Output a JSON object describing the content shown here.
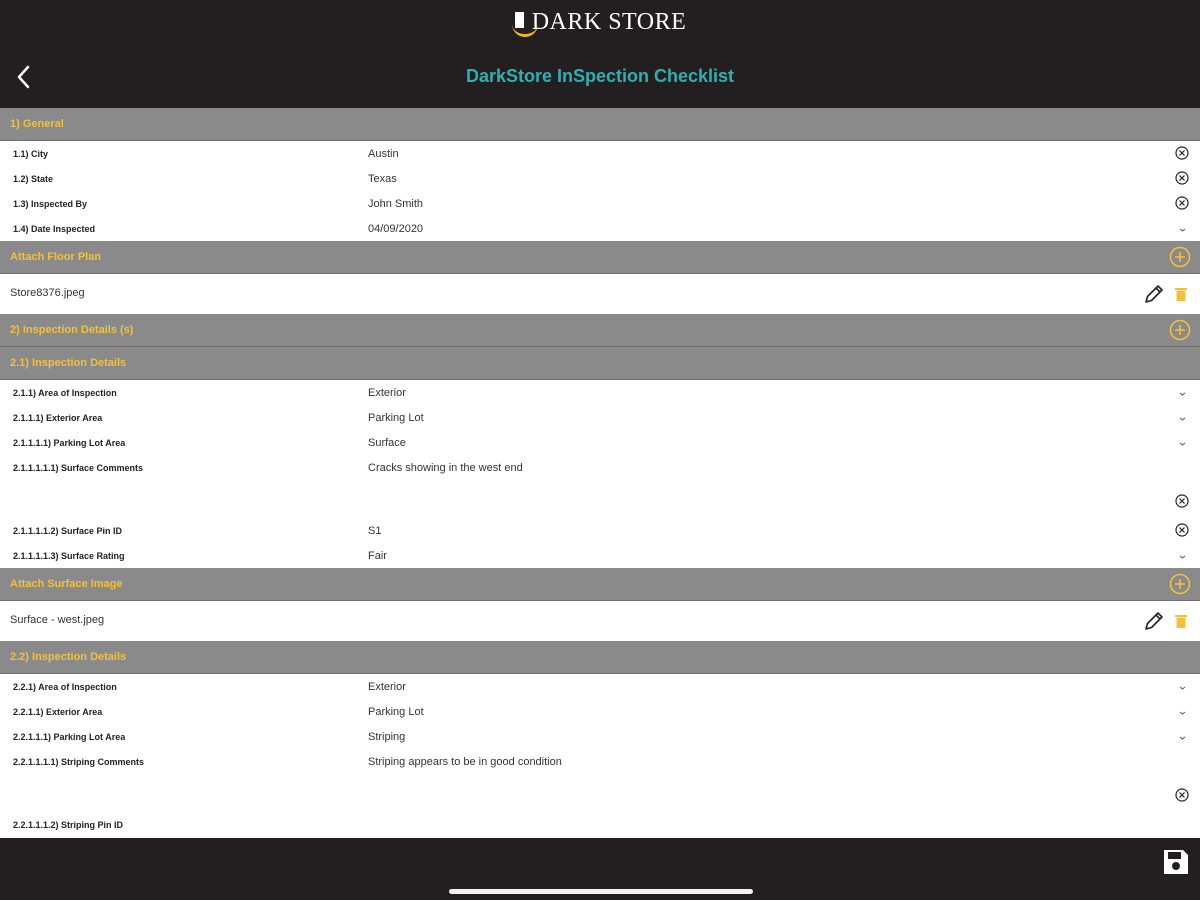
{
  "header": {
    "brand": "DARK STORE",
    "title": "DarkStore InSpection Checklist"
  },
  "sections": {
    "general": {
      "title": "1) General"
    },
    "floor_plan": {
      "title": "Attach Floor Plan",
      "file": "Store8376.jpeg"
    },
    "inspection_details": {
      "title": "2) Inspection Details (s)"
    },
    "details_1": {
      "title": "2.1) Inspection Details"
    },
    "surface_image": {
      "title": "Attach Surface Image",
      "file": "Surface - west.jpeg"
    },
    "details_2": {
      "title": "2.2) Inspection Details"
    }
  },
  "general_rows": [
    {
      "label": "1.1) City",
      "value": "Austin",
      "action": "clear"
    },
    {
      "label": "1.2) State",
      "value": "Texas",
      "action": "clear"
    },
    {
      "label": "1.3) Inspected By",
      "value": "John Smith",
      "action": "clear"
    },
    {
      "label": "1.4) Date Inspected",
      "value": "04/09/2020",
      "action": "dropdown"
    }
  ],
  "details_1_rows": [
    {
      "label": "2.1.1) Area of Inspection",
      "value": "Exterior",
      "action": "dropdown"
    },
    {
      "label": "2.1.1.1) Exterior Area",
      "value": "Parking Lot",
      "action": "dropdown"
    },
    {
      "label": "2.1.1.1.1) Parking Lot Area",
      "value": "Surface",
      "action": "dropdown"
    },
    {
      "label": "2.1.1.1.1.1) Surface Comments",
      "value": "Cracks showing in the west end",
      "action": "clear"
    },
    {
      "label": "2.1.1.1.1.2) Surface Pin ID",
      "value": "S1",
      "action": "clear"
    },
    {
      "label": "2.1.1.1.1.3) Surface Rating",
      "value": "Fair",
      "action": "dropdown"
    }
  ],
  "details_2_rows": [
    {
      "label": "2.2.1) Area of Inspection",
      "value": "Exterior",
      "action": "dropdown"
    },
    {
      "label": "2.2.1.1) Exterior Area",
      "value": "Parking Lot",
      "action": "dropdown"
    },
    {
      "label": "2.2.1.1.1) Parking Lot Area",
      "value": "Striping",
      "action": "dropdown"
    },
    {
      "label": "2.2.1.1.1.1) Striping Comments",
      "value": "Striping appears to be in good condition",
      "action": "clear"
    },
    {
      "label": "2.2.1.1.1.2) Striping Pin ID",
      "value": "",
      "action": "none"
    }
  ],
  "icons": {
    "back": "chevron-left-icon",
    "clear": "clear-circle-icon",
    "dropdown": "chevron-down-icon",
    "add": "add-circle-icon",
    "edit": "pencil-icon",
    "delete": "trash-icon",
    "save": "floppy-disk-icon"
  },
  "colors": {
    "bar_background": "#231f20",
    "title": "#2eb0b3",
    "section_background": "#8a8a8a",
    "accent": "#f3c03a"
  }
}
